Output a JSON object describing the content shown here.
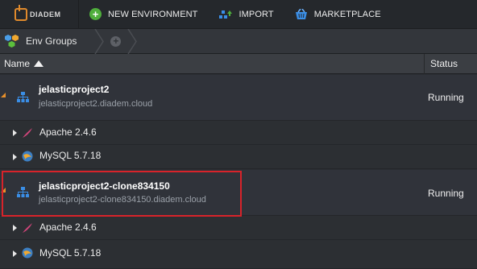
{
  "toolbar": {
    "logo": "DIADEM",
    "new_env": "NEW ENVIRONMENT",
    "import": "IMPORT",
    "marketplace": "MARKETPLACE"
  },
  "breadcrumb": {
    "label": "Env Groups"
  },
  "table": {
    "col_name": "Name",
    "col_status": "Status"
  },
  "envs": [
    {
      "name": "jelasticproject2",
      "domain": "jelasticproject2.diadem.cloud",
      "status": "Running",
      "nodes": [
        {
          "name": "Apache 2.4.6",
          "icon": "apache-feather-icon"
        },
        {
          "name": "MySQL 5.7.18",
          "icon": "mysql-icon"
        }
      ]
    },
    {
      "name": "jelasticproject2-clone834150",
      "domain": "jelasticproject2-clone834150.diadem.cloud",
      "status": "Running",
      "nodes": [
        {
          "name": "Apache 2.4.6",
          "icon": "apache-feather-icon"
        },
        {
          "name": "MySQL 5.7.18",
          "icon": "mysql-icon"
        }
      ]
    }
  ],
  "colors": {
    "accent": "#e8902a",
    "highlight": "#d8232a",
    "new": "#4fae3c"
  }
}
